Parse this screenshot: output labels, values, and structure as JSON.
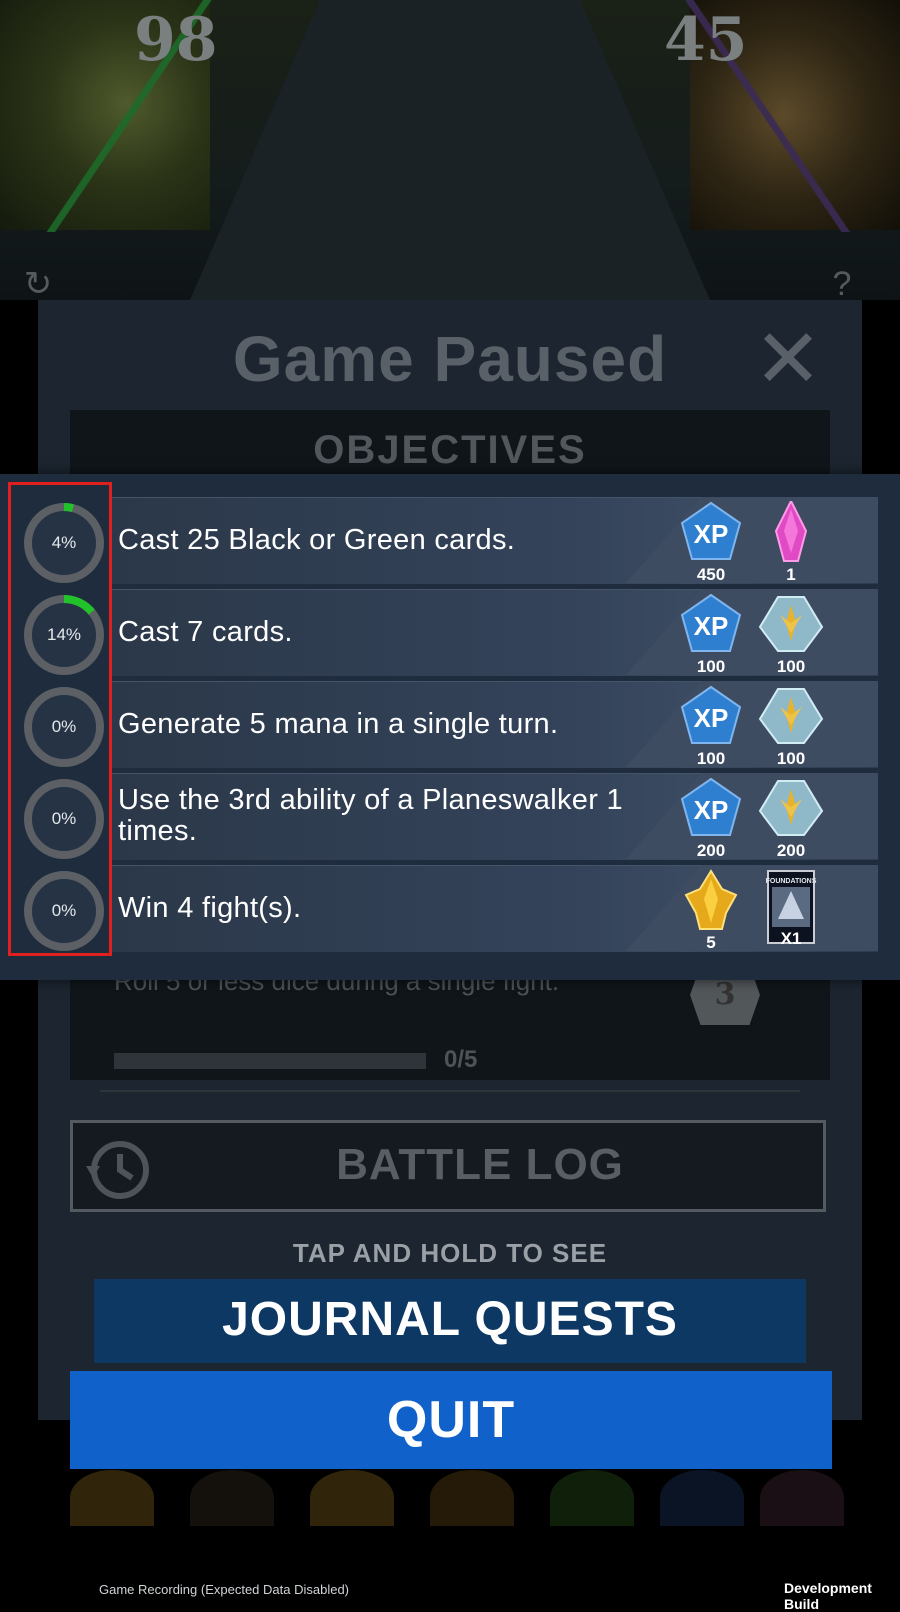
{
  "board": {
    "left_life": "98",
    "right_life": "45"
  },
  "pause_panel": {
    "title": "Game Paused",
    "objectives_header": "OBJECTIVES",
    "ghost_objective_text": "Roll 5 or less dice during a single fight.",
    "ghost_objective_progress": "0/5",
    "ghost_badge_number": "3",
    "battle_log_label": "BATTLE LOG",
    "tap_hint": "TAP AND HOLD TO SEE",
    "journal_quests_label": "JOURNAL QUESTS",
    "quit_label": "QUIT"
  },
  "objectives": [
    {
      "progress_label": "4%",
      "progress_value": 0.04,
      "text": "Cast 25 Black or Green cards.",
      "rewards": [
        {
          "icon": "xp-icon",
          "label": "XP",
          "value": "450"
        },
        {
          "icon": "crystal-shard-icon",
          "value": "1"
        }
      ]
    },
    {
      "progress_label": "14%",
      "progress_value": 0.14,
      "text": "Cast 7 cards.",
      "rewards": [
        {
          "icon": "xp-icon",
          "label": "XP",
          "value": "100"
        },
        {
          "icon": "mastery-gem-icon",
          "value": "100"
        }
      ]
    },
    {
      "progress_label": "0%",
      "progress_value": 0,
      "text": "Generate 5 mana in a single turn.",
      "rewards": [
        {
          "icon": "xp-icon",
          "label": "XP",
          "value": "100"
        },
        {
          "icon": "mastery-gem-icon",
          "value": "100"
        }
      ]
    },
    {
      "progress_label": "0%",
      "progress_value": 0,
      "text": "Use the 3rd ability of a Planeswalker 1 times.",
      "rewards": [
        {
          "icon": "xp-icon",
          "label": "XP",
          "value": "200"
        },
        {
          "icon": "mastery-gem-icon",
          "value": "200"
        }
      ]
    },
    {
      "progress_label": "0%",
      "progress_value": 0,
      "text": "Win 4 fight(s).",
      "rewards": [
        {
          "icon": "gold-crystal-icon",
          "value": "5"
        },
        {
          "icon": "card-pack-icon",
          "pack_name": "FOUNDATIONS",
          "value": "X1"
        }
      ]
    }
  ],
  "colors": {
    "progress_green": "#22c22a",
    "ring_gray": "#5c6064",
    "xp_blue": "#2f7fd1",
    "highlight_red": "#e0201f",
    "quit_blue": "#1061c9",
    "journal_navy": "#0e3864"
  },
  "footer": {
    "recording_notice": "Game Recording (Expected Data Disabled)",
    "build_label": "Development Build"
  }
}
